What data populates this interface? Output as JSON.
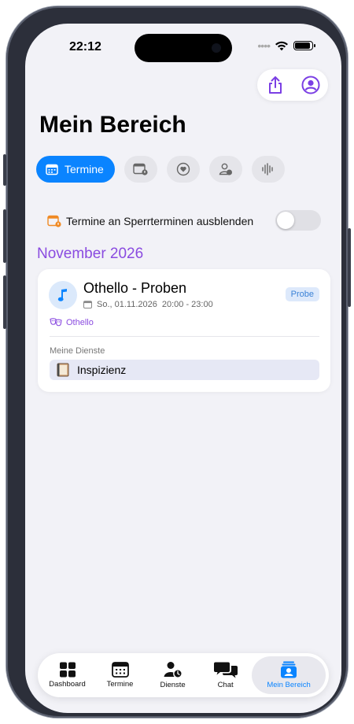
{
  "status": {
    "time": "22:12"
  },
  "page": {
    "title": "Mein Bereich"
  },
  "filters": {
    "active_label": "Termine"
  },
  "toggle": {
    "label": "Termine an Sperrterminen ausblenden",
    "on": false
  },
  "month": "November 2026",
  "event": {
    "title": "Othello - Proben",
    "date": "So., 01.11.2026",
    "time": "20:00 - 23:00",
    "badge": "Probe",
    "production": "Othello",
    "services_label": "Meine Dienste",
    "service": "Inspizienz"
  },
  "tabs": [
    {
      "label": "Dashboard"
    },
    {
      "label": "Termine"
    },
    {
      "label": "Dienste"
    },
    {
      "label": "Chat"
    },
    {
      "label": "Mein Bereich"
    }
  ],
  "colors": {
    "accent": "#0a84ff",
    "purple": "#8a4be0",
    "background": "#f2f2f7"
  }
}
